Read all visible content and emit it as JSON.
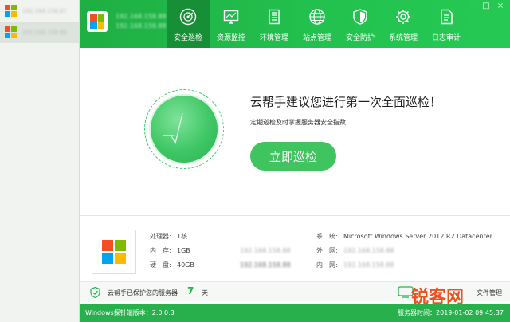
{
  "sidebar": {
    "servers": [
      {
        "name": "192.168.158.87"
      },
      {
        "name": "192.168.158.88"
      }
    ]
  },
  "app": {
    "title_line1": "192.168.158.88",
    "title_line2": "192.168.158.88",
    "window_controls": [
      "minimize",
      "maximize",
      "close"
    ]
  },
  "nav": {
    "tabs": [
      {
        "label": "安全巡检",
        "icon": "radar-icon",
        "active": true
      },
      {
        "label": "资源监控",
        "icon": "monitor-chart-icon",
        "active": false
      },
      {
        "label": "环境管理",
        "icon": "server-rack-icon",
        "active": false
      },
      {
        "label": "站点管理",
        "icon": "globe-icon",
        "active": false
      },
      {
        "label": "安全防护",
        "icon": "shield-icon",
        "active": false
      },
      {
        "label": "系统管理",
        "icon": "gear-icon",
        "active": false
      },
      {
        "label": "日志审计",
        "icon": "document-icon",
        "active": false
      }
    ]
  },
  "hero": {
    "headline": "云帮手建议您进行第一次全面巡检！",
    "subline": "定期巡检及时掌握服务器安全指数!",
    "button_label": "立即巡检"
  },
  "info": {
    "cpu_label": "处理器:",
    "cpu_value": "1核",
    "mem_label": "内　存:",
    "mem_value": "1GB",
    "disk_label": "硬　盘:",
    "disk_value": "40GB",
    "os_label": "系　统:",
    "os_value": "Microsoft Windows Server 2012 R2 Datacenter",
    "ext_ip_label": "外　网:",
    "ext_ip_value": "192.168.158.88",
    "int_ip_label": "内　网:",
    "int_ip_value": "192.168.158.88",
    "blurred_1": "192.168.158.88",
    "blurred_2": "192.168.158.88",
    "blurred_3": "192.168.158.88"
  },
  "protect": {
    "text": "云帮手已保护您的服务器",
    "days": "7",
    "unit": "天",
    "file_manager": "文件管理"
  },
  "watermark": "锐客网",
  "status": {
    "version": "Windows探针端版本：2.0.0.3",
    "server_time": "服务器时间：2019-01-02 09:45:37"
  },
  "colors": {
    "brand_green": "#23c24f",
    "active_tab": "#178f36",
    "button_green": "#3fc45f",
    "watermark_orange": "#f0511c"
  }
}
